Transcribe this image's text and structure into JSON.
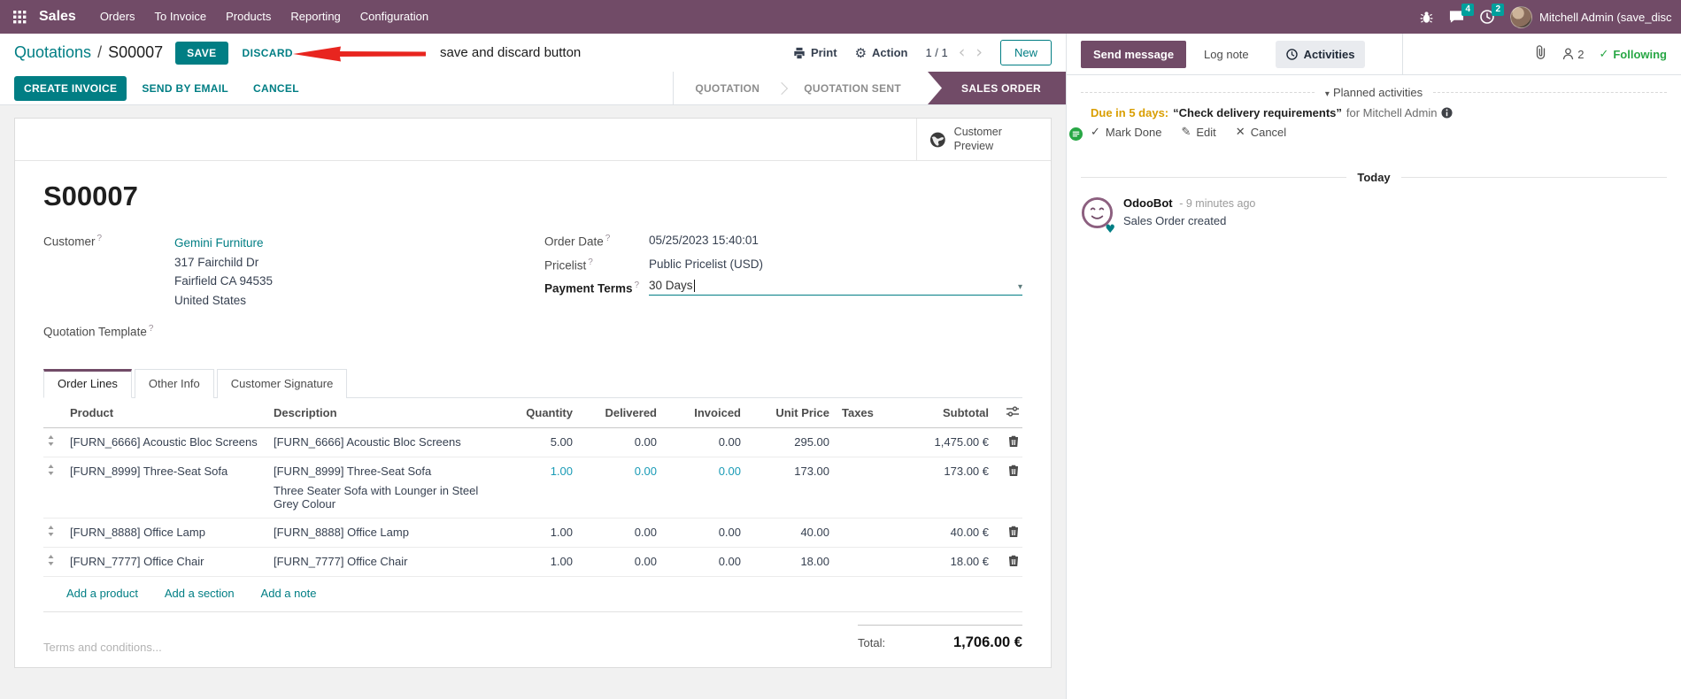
{
  "nav": {
    "app_name": "Sales",
    "menus": [
      {
        "label": "Orders"
      },
      {
        "label": "To Invoice"
      },
      {
        "label": "Products"
      },
      {
        "label": "Reporting"
      },
      {
        "label": "Configuration"
      }
    ],
    "messages_badge": "4",
    "activities_badge": "2",
    "user_name": "Mitchell Admin (save_discar"
  },
  "breadcrumb": {
    "parent": "Quotations",
    "separator": "/",
    "current": "S00007",
    "save_label": "SAVE",
    "discard_label": "DISCARD",
    "annotation": "save and discard button",
    "print_label": "Print",
    "action_label": "Action",
    "pager_value": "1 / 1",
    "prev_glyph": "‹",
    "next_glyph": "›",
    "new_label": "New"
  },
  "statusbar": {
    "create_invoice_label": "CREATE INVOICE",
    "send_by_email_label": "SEND BY EMAIL",
    "cancel_label": "CANCEL",
    "stages": [
      {
        "label": "QUOTATION"
      },
      {
        "label": "QUOTATION SENT"
      },
      {
        "label": "SALES ORDER"
      }
    ],
    "active_stage": "SALES ORDER"
  },
  "sheet": {
    "customer_preview_label": "Customer Preview",
    "order_ref": "S00007",
    "help_marker": "?",
    "customer": {
      "label": "Customer",
      "name": "Gemini Furniture",
      "street": "317 Fairchild Dr",
      "city": "Fairfield CA 94535",
      "country": "United States"
    },
    "quotation_template_label": "Quotation Template",
    "order_date": {
      "label": "Order Date",
      "value": "05/25/2023 15:40:01"
    },
    "pricelist": {
      "label": "Pricelist",
      "value": "Public Pricelist (USD)"
    },
    "payment_terms": {
      "label": "Payment Terms",
      "value": "30 Days",
      "caret": "▾"
    },
    "tabs": [
      {
        "label": "Order Lines"
      },
      {
        "label": "Other Info"
      },
      {
        "label": "Customer Signature"
      }
    ],
    "active_tab": "Order Lines"
  },
  "order_lines": {
    "columns": {
      "product": "Product",
      "description": "Description",
      "quantity": "Quantity",
      "delivered": "Delivered",
      "invoiced": "Invoiced",
      "unit_price": "Unit Price",
      "taxes": "Taxes",
      "subtotal": "Subtotal"
    },
    "rows": [
      {
        "product": "[FURN_6666] Acoustic Bloc Screens",
        "description": "[FURN_6666] Acoustic Bloc Screens",
        "quantity": "5.00",
        "delivered": "0.00",
        "invoiced": "0.00",
        "unit_price": "295.00",
        "taxes": "",
        "subtotal": "1,475.00 €"
      },
      {
        "product": "[FURN_8999] Three-Seat Sofa",
        "description": "[FURN_8999] Three-Seat Sofa",
        "description_line2": "Three Seater Sofa with Lounger in Steel Grey Colour",
        "quantity": "1.00",
        "delivered": "0.00",
        "invoiced": "0.00",
        "unit_price": "173.00",
        "taxes": "",
        "subtotal": "173.00 €"
      },
      {
        "product": "[FURN_8888] Office Lamp",
        "description": "[FURN_8888] Office Lamp",
        "quantity": "1.00",
        "delivered": "0.00",
        "invoiced": "0.00",
        "unit_price": "40.00",
        "taxes": "",
        "subtotal": "40.00 €"
      },
      {
        "product": "[FURN_7777] Office Chair",
        "description": "[FURN_7777] Office Chair",
        "quantity": "1.00",
        "delivered": "0.00",
        "invoiced": "0.00",
        "unit_price": "18.00",
        "taxes": "",
        "subtotal": "18.00 €"
      }
    ],
    "add_product_label": "Add a product",
    "add_section_label": "Add a section",
    "add_note_label": "Add a note",
    "terms_placeholder": "Terms and conditions...",
    "total_label": "Total:",
    "total_value": "1,706.00 €"
  },
  "chatter": {
    "send_message_label": "Send message",
    "log_note_label": "Log note",
    "activities_label": "Activities",
    "followers_count": "2",
    "following_check": "✓",
    "following_label": "Following",
    "planned_caret": "▾",
    "planned_activities_label": "Planned activities",
    "activity": {
      "due": "Due in 5 days:",
      "summary": "“Check delivery requirements”",
      "assignee": "for Mitchell Admin",
      "mark_done_check": "✓",
      "mark_done_label": "Mark Done",
      "edit_glyph": "✎",
      "edit_label": "Edit",
      "cancel_glyph": "✕",
      "cancel_label": "Cancel"
    },
    "today_label": "Today",
    "message": {
      "author": "OdooBot",
      "time": "- 9 minutes ago",
      "body": "Sales Order created"
    }
  },
  "colors": {
    "brand_purple": "#714B67",
    "primary_teal": "#017E84",
    "badge_teal": "#00A09D",
    "modified_blue": "#1a9bb6",
    "due_orange": "#d99e00",
    "following_green": "#28a745",
    "arrow_red": "#e8251f"
  }
}
